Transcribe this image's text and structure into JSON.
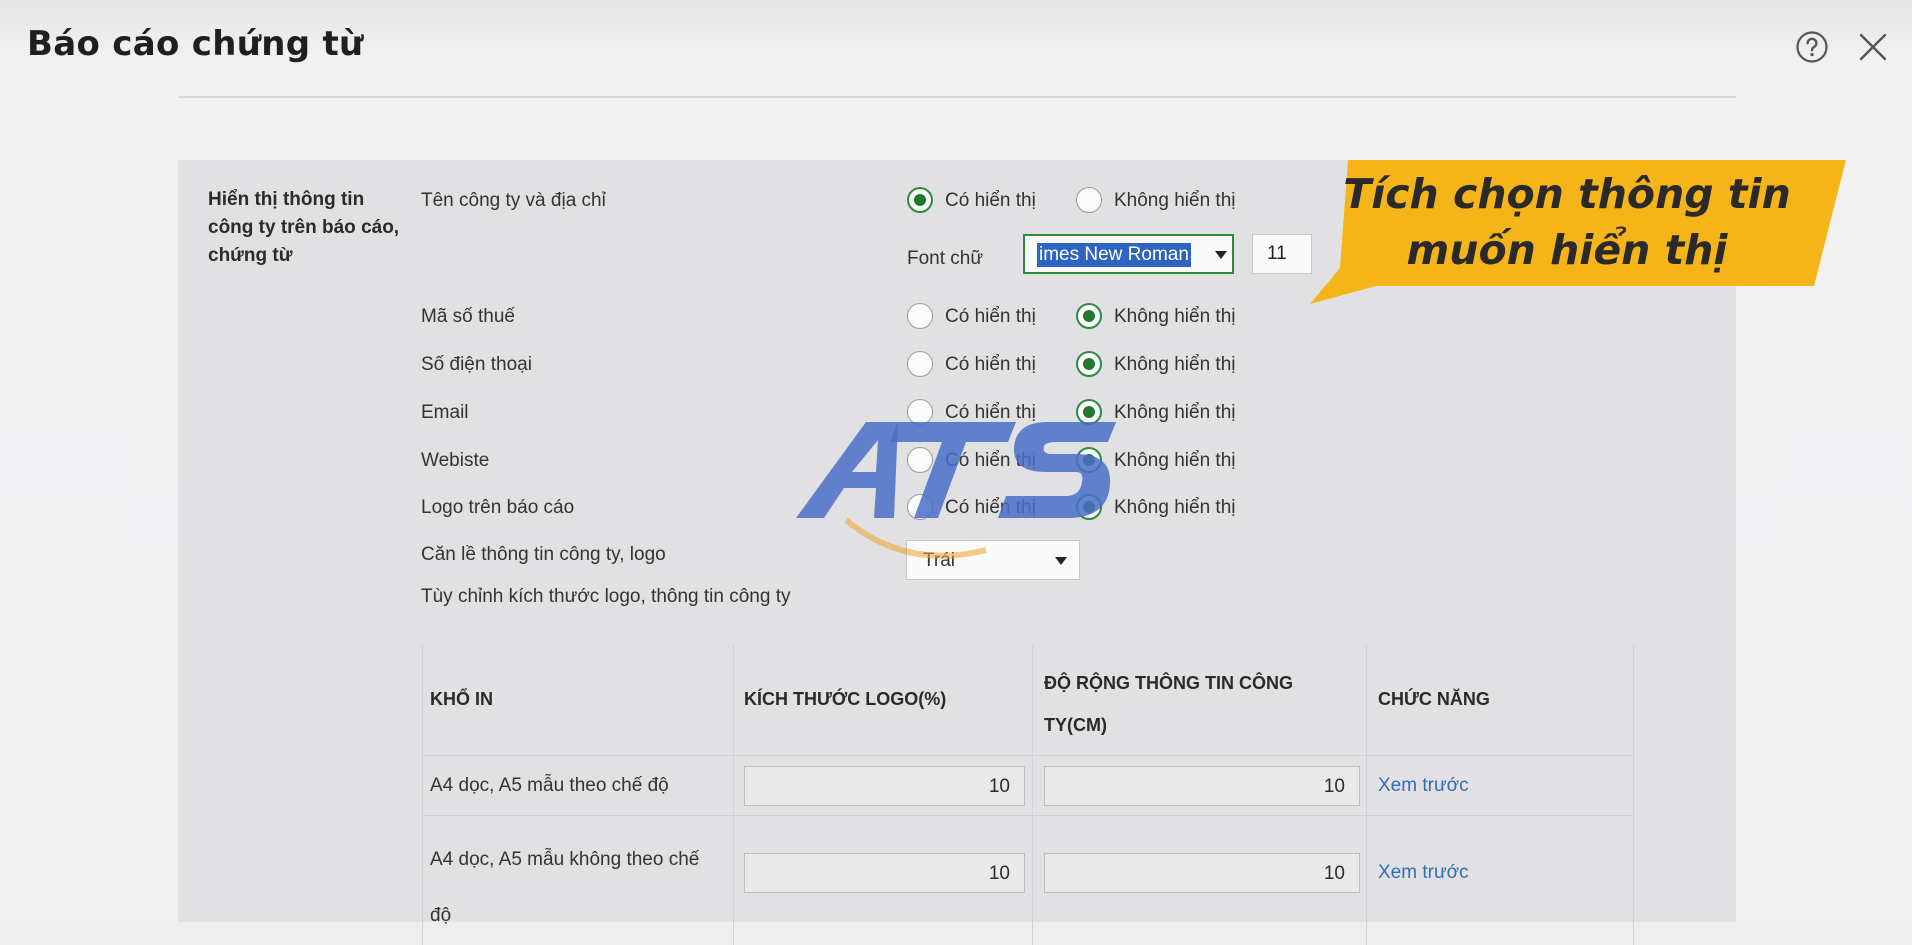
{
  "dialog": {
    "title": "Báo cáo chứng từ",
    "help_icon": "question-circle-icon",
    "close_icon": "close-icon"
  },
  "section": {
    "label": "Hiển thị thông tin công ty trên báo cáo, chứng từ",
    "rows": [
      {
        "label": "Tên công ty và địa chỉ",
        "option_show": "Có hiển thị",
        "option_hide": "Không hiển thị",
        "selected": "show"
      },
      {
        "label": "Mã số thuế",
        "option_show": "Có hiển thị",
        "option_hide": "Không hiển thị",
        "selected": "hide"
      },
      {
        "label": "Số điện thoại",
        "option_show": "Có hiển thị",
        "option_hide": "Không hiển thị",
        "selected": "hide"
      },
      {
        "label": "Email",
        "option_show": "Có hiển thị",
        "option_hide": "Không hiển thị",
        "selected": "hide"
      },
      {
        "label": "Webiste",
        "option_show": "Có hiển thị",
        "option_hide": "Không hiển thị",
        "selected": "hide"
      },
      {
        "label": "Logo trên báo cáo",
        "option_show": "Có hiển thị",
        "option_hide": "Không hiển thị",
        "selected": "hide"
      }
    ],
    "font_label": "Font chữ",
    "font_value": "imes New Roman",
    "font_size": "11",
    "align_label": "Căn lề thông tin công ty, logo",
    "align_value": "Trái",
    "custom_label": "Tùy chỉnh kích thước logo, thông tin công ty"
  },
  "table": {
    "headers": [
      "KHỔ IN",
      "KÍCH THƯỚC LOGO(%)",
      "ĐỘ RỘNG THÔNG TIN CÔNG TY(CM)",
      "CHỨC NĂNG"
    ],
    "rows": [
      {
        "kho_in": "A4 dọc, A5 mẫu theo chế độ",
        "logo_size": "10",
        "info_width": "10",
        "action": "Xem trước"
      },
      {
        "kho_in": "A4 dọc, A5 mẫu không theo chế độ",
        "logo_size": "10",
        "info_width": "10",
        "action": "Xem trước"
      }
    ]
  },
  "callout": {
    "text_line1": "Tích chọn thông tin",
    "text_line2": "muốn hiển thị",
    "color": "#f5b417"
  },
  "watermark": {
    "text": "ATS",
    "color_blue": "#4a6fc8",
    "color_orange": "#f0a030"
  },
  "colors": {
    "radio_selected": "#1f7a2f",
    "link": "#2f6fb5",
    "selection": "#2f63c0"
  }
}
